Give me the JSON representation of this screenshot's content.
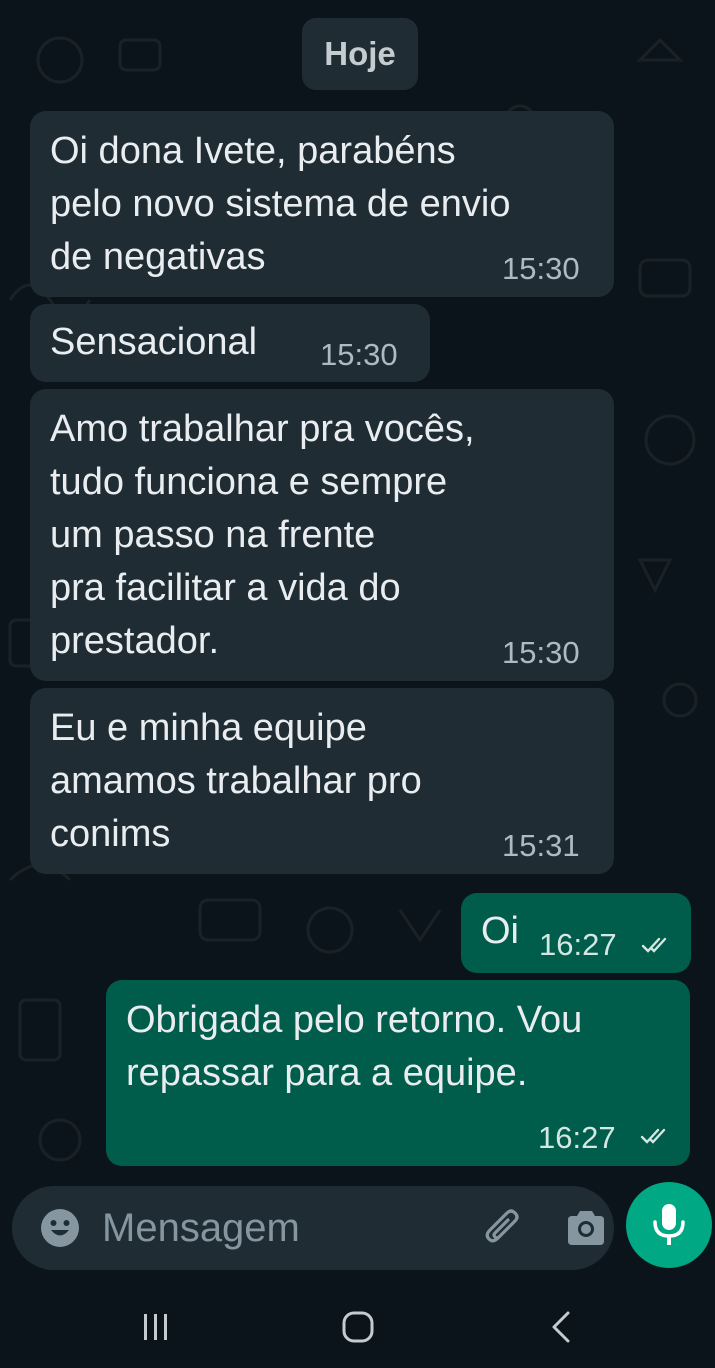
{
  "date_separator": "Hoje",
  "messages": [
    {
      "direction": "in",
      "text": "Oi dona Ivete, parabéns\npelo novo sistema de envio\nde negativas",
      "time": "15:30"
    },
    {
      "direction": "in",
      "text": "Sensacional",
      "time": "15:30"
    },
    {
      "direction": "in",
      "text": "Amo trabalhar pra vocês,\ntudo funciona e sempre\num passo na frente\npra facilitar a vida do\nprestador.",
      "time": "15:30"
    },
    {
      "direction": "in",
      "text": "Eu e minha equipe\namamos trabalhar pro\nconims",
      "time": "15:31"
    },
    {
      "direction": "out",
      "text": "Oi",
      "time": "16:27",
      "status": "read"
    },
    {
      "direction": "out",
      "text": "Obrigada pelo retorno. Vou\nrepassar para a equipe.",
      "time": "16:27",
      "status": "read"
    }
  ],
  "composer": {
    "placeholder": "Mensagem",
    "icons": [
      "emoji-icon",
      "attach-icon",
      "camera-icon",
      "mic-icon"
    ]
  },
  "navbar": {
    "icons": [
      "recent-apps-icon",
      "home-icon",
      "back-icon"
    ]
  },
  "colors": {
    "background": "#0b141a",
    "incoming_bubble": "#1f2c34",
    "outgoing_bubble": "#005c4b",
    "accent": "#00a884",
    "text": "#e9edef",
    "meta_text": "#aebac1"
  }
}
